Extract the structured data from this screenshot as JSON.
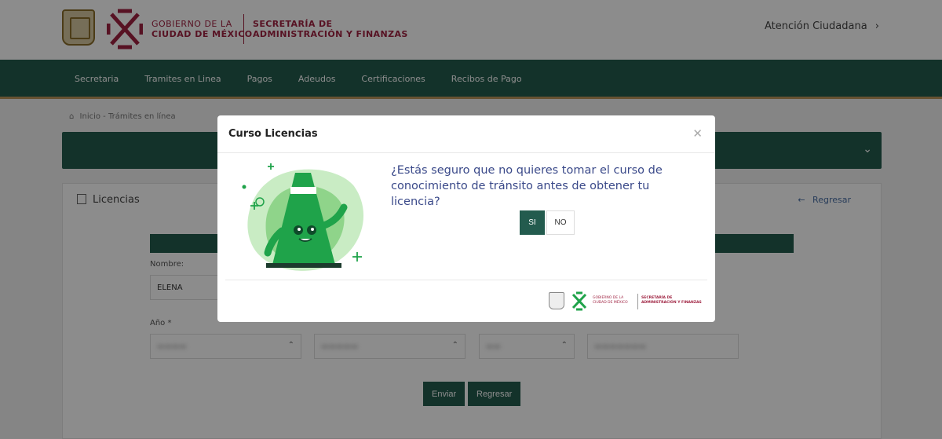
{
  "header": {
    "gov_line1": "GOBIERNO DE LA",
    "gov_line2": "CIUDAD DE MÉXICO",
    "secretaria_line1": "SECRETARÍA DE",
    "secretaria_line2": "ADMINISTRACIÓN Y FINANZAS",
    "atencion": "Atención Ciudadana",
    "atencion_icon": "chevron-right-icon"
  },
  "nav": {
    "items": [
      "Secretaria",
      "Tramites en Linea",
      "Pagos",
      "Adeudos",
      "Certificaciones",
      "Recibos de Pago"
    ]
  },
  "breadcrumb": "Inicio - Trámites en línea",
  "card": {
    "title": "Licencias",
    "back_link": "Regresar"
  },
  "form": {
    "nombre_label": "Nombre:",
    "nombre_value": "ELENA",
    "anio_label": "Año *",
    "enviar": "Enviar",
    "regresar": "Regresar"
  },
  "modal": {
    "title": "Curso Licencias",
    "question": "¿Estás seguro que no quieres tomar el curso de conocimiento de tránsito antes de obtener tu licencia?",
    "yes_label": "SI",
    "no_label": "NO",
    "close_icon": "close-icon",
    "footer_gov_line1": "GOBIERNO DE LA",
    "footer_gov_line2": "CIUDAD DE MÉXICO",
    "footer_secr_line1": "SECRETARÍA DE",
    "footer_secr_line2": "ADMINISTRACIÓN Y FINANZAS"
  },
  "colors": {
    "primary_green": "#235b4e",
    "brand_maroon": "#9f2241",
    "gold": "#bc955c",
    "mascot_green": "#1fa34a"
  }
}
